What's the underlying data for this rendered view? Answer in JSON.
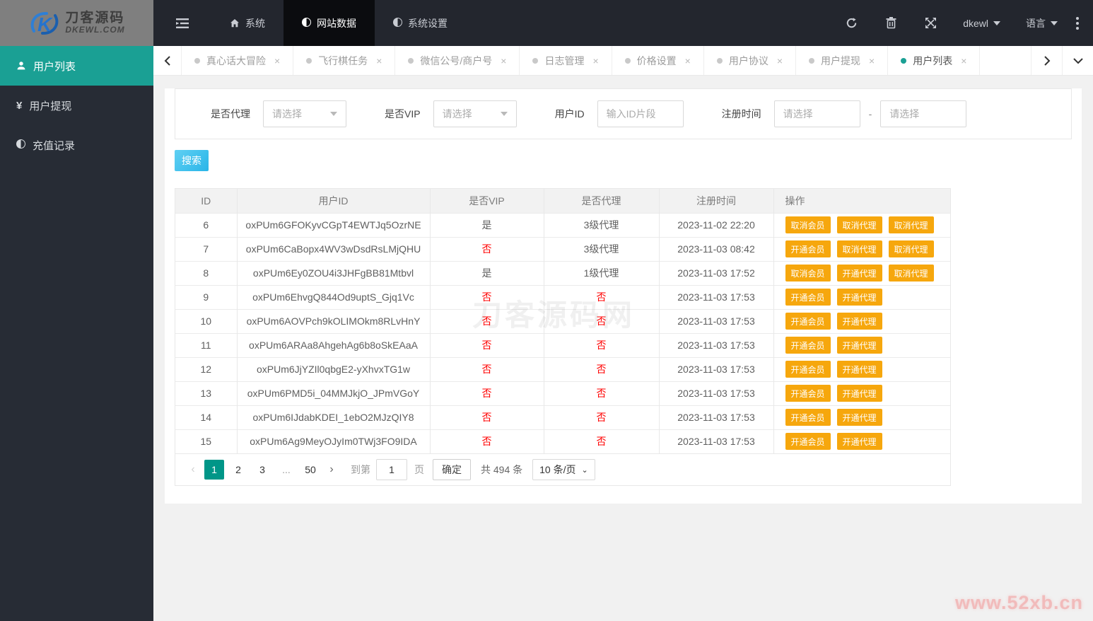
{
  "topbar": {
    "brand_cn": "刀客源码",
    "brand_en": "DKEWL.COM",
    "nav": [
      {
        "label": "系统",
        "icon": "home-icon",
        "active": false
      },
      {
        "label": "网站数据",
        "icon": "adjust-icon",
        "active": true
      },
      {
        "label": "系统设置",
        "icon": "adjust-icon",
        "active": false
      }
    ],
    "username": "dkewl",
    "language_label": "语言"
  },
  "tabbar": {
    "tabs": [
      {
        "label": "真心话大冒险",
        "active": false
      },
      {
        "label": "飞行棋任务",
        "active": false
      },
      {
        "label": "微信公号/商户号",
        "active": false
      },
      {
        "label": "日志管理",
        "active": false
      },
      {
        "label": "价格设置",
        "active": false
      },
      {
        "label": "用户协议",
        "active": false
      },
      {
        "label": "用户提现",
        "active": false
      },
      {
        "label": "用户列表",
        "active": true
      }
    ]
  },
  "sidebar": [
    {
      "label": "用户列表",
      "icon": "user-icon",
      "active": true
    },
    {
      "label": "用户提现",
      "icon": "yen-icon",
      "active": false
    },
    {
      "label": "充值记录",
      "icon": "adjust-icon",
      "active": false
    }
  ],
  "filters": {
    "agent_label": "是否代理",
    "vip_label": "是否VIP",
    "userid_label": "用户ID",
    "time_label": "注册时间",
    "select_placeholder": "请选择",
    "userid_placeholder": "输入ID片段",
    "range_separator": "-"
  },
  "search_button": "搜索",
  "table": {
    "headers": [
      "ID",
      "用户ID",
      "是否VIP",
      "是否代理",
      "注册时间",
      "操作"
    ],
    "rows": [
      {
        "id": "6",
        "user_id": "oxPUm6GFOKyvCGpT4EWTJq5OzrNE",
        "vip": "是",
        "agent": "3级代理",
        "time": "2023-11-02 22:20",
        "actions": [
          "取消会员",
          "取消代理",
          "取消代理"
        ]
      },
      {
        "id": "7",
        "user_id": "oxPUm6CaBopx4WV3wDsdRsLMjQHU",
        "vip": "否",
        "agent": "3级代理",
        "time": "2023-11-03 08:42",
        "actions": [
          "开通会员",
          "取消代理",
          "取消代理"
        ]
      },
      {
        "id": "8",
        "user_id": "oxPUm6Ey0ZOU4i3JHFgBB81Mtbvl",
        "vip": "是",
        "agent": "1级代理",
        "time": "2023-11-03 17:52",
        "actions": [
          "取消会员",
          "开通代理",
          "取消代理"
        ]
      },
      {
        "id": "9",
        "user_id": "oxPUm6EhvgQ844Od9uptS_Gjq1Vc",
        "vip": "否",
        "agent": "否",
        "time": "2023-11-03 17:53",
        "actions": [
          "开通会员",
          "开通代理"
        ]
      },
      {
        "id": "10",
        "user_id": "oxPUm6AOVPch9kOLIMOkm8RLvHnY",
        "vip": "否",
        "agent": "否",
        "time": "2023-11-03 17:53",
        "actions": [
          "开通会员",
          "开通代理"
        ]
      },
      {
        "id": "11",
        "user_id": "oxPUm6ARAa8AhgehAg6b8oSkEAaA",
        "vip": "否",
        "agent": "否",
        "time": "2023-11-03 17:53",
        "actions": [
          "开通会员",
          "开通代理"
        ]
      },
      {
        "id": "12",
        "user_id": "oxPUm6JjYZIl0qbgE2-yXhvxTG1w",
        "vip": "否",
        "agent": "否",
        "time": "2023-11-03 17:53",
        "actions": [
          "开通会员",
          "开通代理"
        ]
      },
      {
        "id": "13",
        "user_id": "oxPUm6PMD5i_04MMJkjO_JPmVGoY",
        "vip": "否",
        "agent": "否",
        "time": "2023-11-03 17:53",
        "actions": [
          "开通会员",
          "开通代理"
        ]
      },
      {
        "id": "14",
        "user_id": "oxPUm6IJdabKDEI_1ebO2MJzQIY8",
        "vip": "否",
        "agent": "否",
        "time": "2023-11-03 17:53",
        "actions": [
          "开通会员",
          "开通代理"
        ]
      },
      {
        "id": "15",
        "user_id": "oxPUm6Ag9MeyOJyIm0TWj3FO9IDA",
        "vip": "否",
        "agent": "否",
        "time": "2023-11-03 17:53",
        "actions": [
          "开通会员",
          "开通代理"
        ]
      }
    ]
  },
  "pagination": {
    "prev": "‹",
    "next": "›",
    "pages": [
      "1",
      "2",
      "3",
      "...",
      "50"
    ],
    "active_page": "1",
    "goto_label": "到第",
    "goto_value": "1",
    "page_label": "页",
    "confirm_label": "确定",
    "total_label": "共 494 条",
    "page_size": "10 条/页"
  },
  "watermark": "刀客源码网",
  "footer_mark": "www.52xb.cn",
  "colors": {
    "accent_teal": "#1aa094",
    "action_orange": "#f6a70d",
    "negative_red": "#ff0000",
    "pager_active": "#009688"
  }
}
